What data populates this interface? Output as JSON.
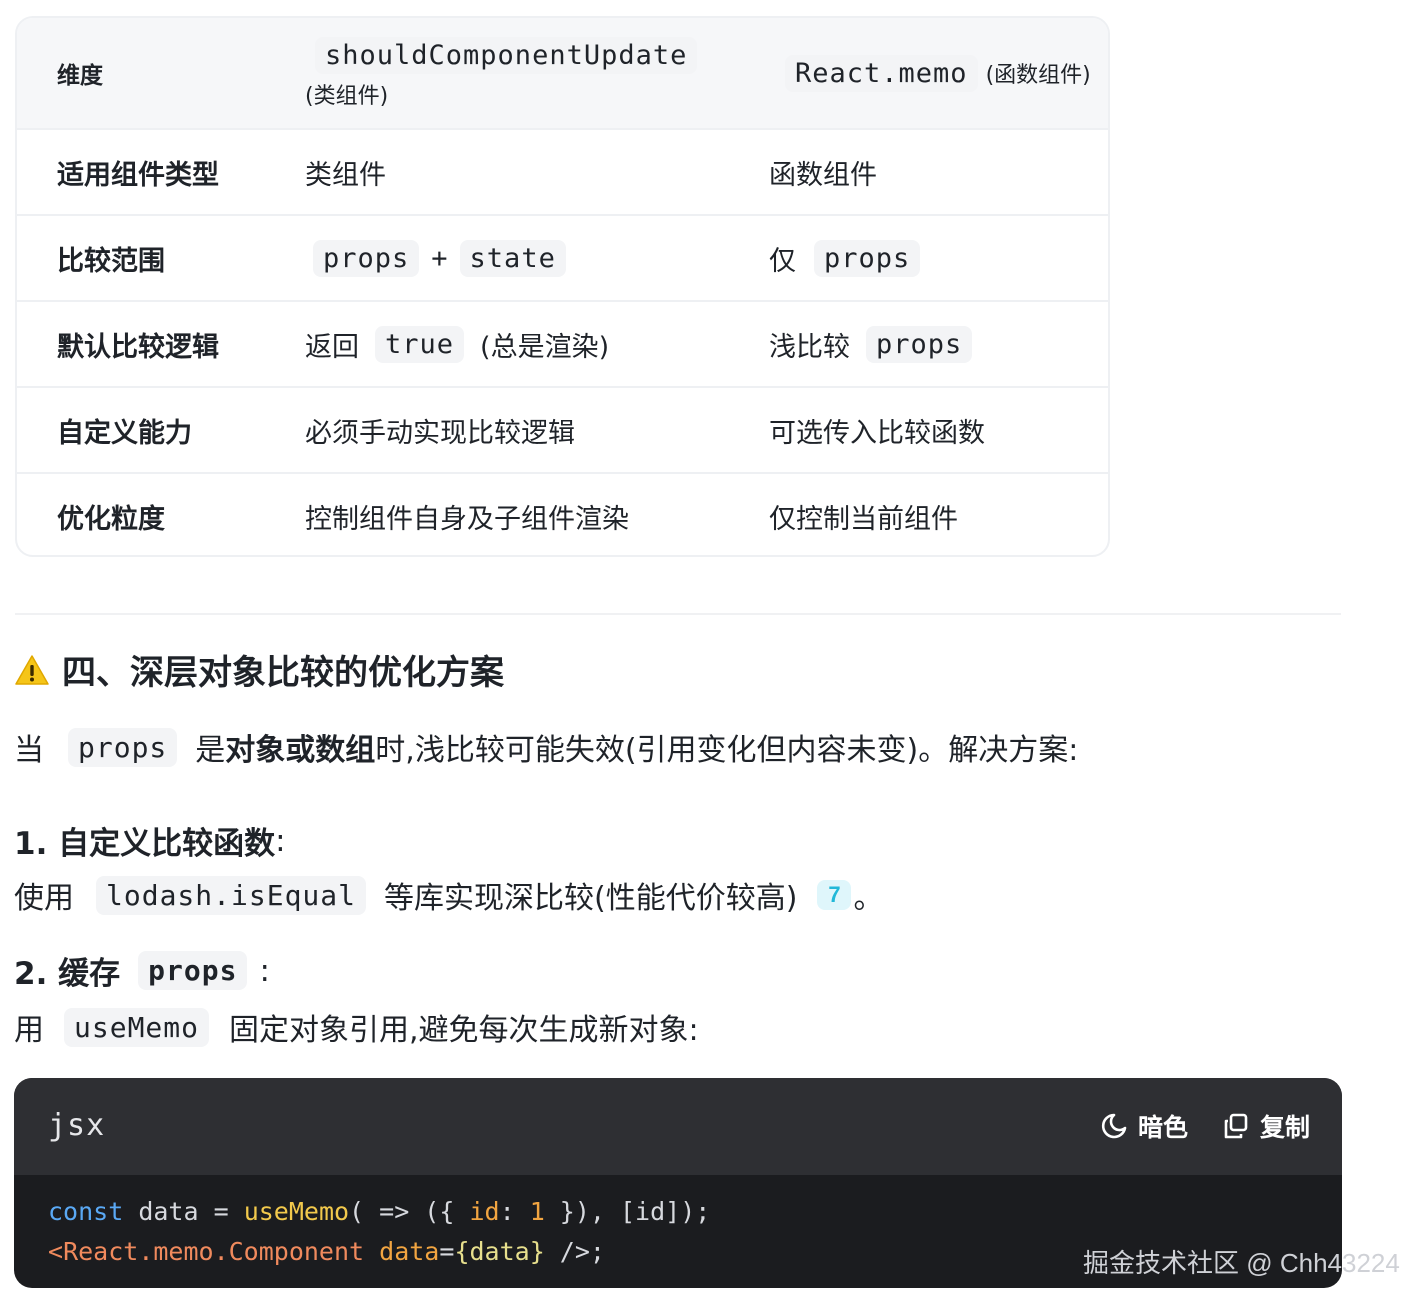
{
  "table": {
    "header": {
      "col1": "维度",
      "col2_code": "shouldComponentUpdate",
      "col2_note": "(类组件)",
      "col3_code": "React.memo",
      "col3_note": "(函数组件)"
    },
    "rows": [
      {
        "dim": "适用组件类型",
        "a": "类组件",
        "b": "函数组件"
      },
      {
        "dim": "比较范围",
        "a_code1": "props",
        "a_plus": "+",
        "a_code2": "state",
        "b_pre": "仅",
        "b_code": "props"
      },
      {
        "dim": "默认比较逻辑",
        "a_pre": "返回",
        "a_code": "true",
        "a_post": "(总是渲染)",
        "b_pre": "浅比较",
        "b_code": "props"
      },
      {
        "dim": "自定义能力",
        "a": "必须手动实现比较逻辑",
        "b": "可选传入比较函数"
      },
      {
        "dim": "优化粒度",
        "a": "控制组件自身及子组件渲染",
        "b": "仅控制当前组件"
      }
    ]
  },
  "section": {
    "icon": "warning-icon",
    "title": "四、深层对象比较的优化方案"
  },
  "intro": {
    "pre": "当",
    "code": "props",
    "mid1": "是",
    "bold": "对象或数组",
    "post": "时,浅比较可能失效(引用变化但内容未变)。解决方案:"
  },
  "item1": {
    "title": "1. 自定义比较函数",
    "colon": ":",
    "text_pre": "使用",
    "code": "lodash.isEqual",
    "text_post": "等库实现深比较(性能代价较高)",
    "badge": "7",
    "end": "。"
  },
  "item2": {
    "title": "2. 缓存",
    "code": "props",
    "colon": ":",
    "text_pre": "用",
    "text_code": "useMemo",
    "text_post": "固定对象引用,避免每次生成新对象:"
  },
  "code_block": {
    "lang": "jsx",
    "dark_label": "暗色",
    "copy_label": "复制",
    "line1": {
      "kw": "const",
      "t1": " data = ",
      "fn": "useMemo",
      "t2": "( => ({ ",
      "key": "id",
      "t3": ": ",
      "num": "1",
      "t4": " }), [id]);"
    },
    "line2": {
      "lt": "<",
      "tag": "React.memo.Component",
      "sp": " ",
      "attr": "data",
      "eq": "=",
      "brace": "{data}",
      "end": " />;"
    }
  },
  "watermark": "掘金技术社区 @ Chh43224",
  "colors": {
    "accent_badge": "#21b8d8",
    "code_bg": "#1b1c1f",
    "code_header": "#2e2f33",
    "warning": "#f5c518"
  }
}
